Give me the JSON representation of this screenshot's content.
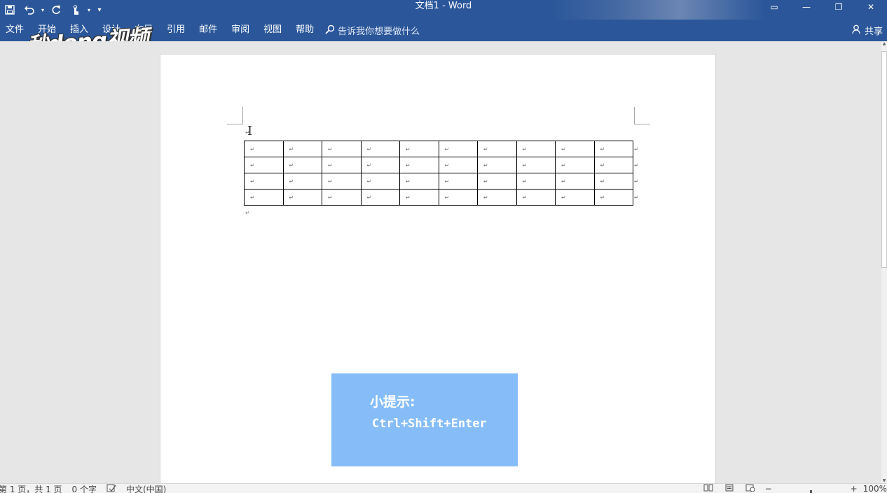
{
  "titlebar": {
    "title": "文档1  -  Word",
    "qat": {
      "save_icon": "save-icon",
      "undo_icon": "undo-icon",
      "redo_icon": "redo-icon",
      "touch_icon": "touch-mode-icon",
      "customize_icon": "customize-qat-icon"
    },
    "window": {
      "ribbon_options": "▭",
      "minimize": "—",
      "restore": "❐",
      "close": "✕"
    }
  },
  "ribbon": {
    "tabs": [
      "文件",
      "开始",
      "插入",
      "设计",
      "布局",
      "引用",
      "邮件",
      "审阅",
      "视图",
      "帮助"
    ],
    "tell_me": "告诉我你想要做什么",
    "share": "共享"
  },
  "watermark": "秒dong视频",
  "document": {
    "cell_mark": "↵",
    "table": {
      "rows": 4,
      "cols": 10
    }
  },
  "tip": {
    "title": "小提示:",
    "shortcut": "Ctrl+Shift+Enter"
  },
  "status": {
    "page": "第 1 页，共 1 页",
    "words": "0 个字",
    "language": "中文(中国)",
    "zoom_percent": "100%",
    "zoom_value": 100
  },
  "colors": {
    "ribbon": "#2b579a",
    "tip_bg": "#86bdf8"
  }
}
